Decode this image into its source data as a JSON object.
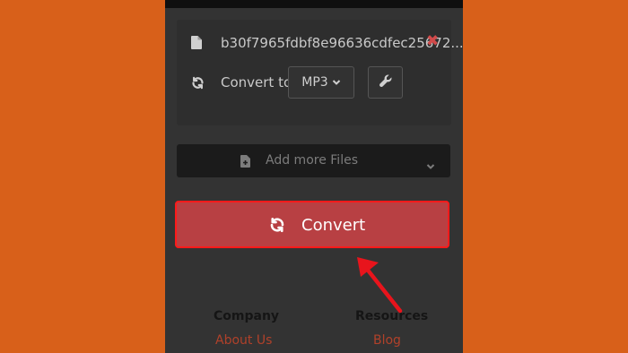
{
  "colors": {
    "background": "#d8601a",
    "panel": "#333333",
    "convert_button": "#b84043",
    "highlight": "#ff1a1a",
    "link": "#b0412a"
  },
  "file": {
    "name": "b30f7965fdbf8e96636cdfec25672..."
  },
  "conversion": {
    "label": "Convert to",
    "format": "MP3"
  },
  "add_files": {
    "label": "Add more Files"
  },
  "convert_button": {
    "label": "Convert"
  },
  "footer": {
    "company": {
      "heading": "Company",
      "link": "About Us"
    },
    "resources": {
      "heading": "Resources",
      "link": "Blog"
    }
  },
  "icons": [
    "file-icon",
    "remove-icon",
    "sync-icon",
    "chevron-down-icon",
    "wrench-icon",
    "file-plus-icon",
    "annotation-arrow"
  ]
}
